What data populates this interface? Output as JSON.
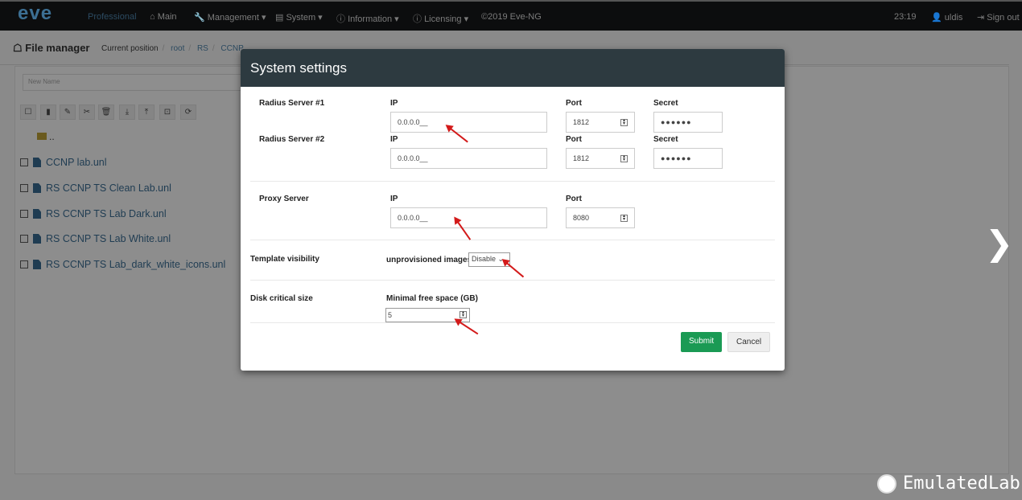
{
  "nav": {
    "logo": "eve",
    "edition": "Professional",
    "items": [
      "Main",
      "Management ▾",
      "System ▾",
      "Information ▾",
      "Licensing ▾"
    ],
    "copyright": "©2019 Eve-NG",
    "time": "23:19",
    "user": "uldis",
    "signout": "Sign out"
  },
  "file_manager": {
    "title": "File manager",
    "current_position": "Current position",
    "breadcrumb": [
      "root",
      "RS",
      "CCNP"
    ],
    "new_name_placeholder": "New Name",
    "up": "..",
    "files": [
      "CCNP lab.unl",
      "RS CCNP TS Clean Lab.unl",
      "RS CCNP TS Lab Dark.unl",
      "RS CCNP TS Lab White.unl",
      "RS CCNP TS Lab_dark_white_icons.unl"
    ],
    "toolbar_icons": [
      "select-all-icon",
      "new-file-icon",
      "edit-icon",
      "cut-icon",
      "delete-icon",
      "import-icon",
      "export-icon",
      "new-folder-icon",
      "refresh-icon"
    ]
  },
  "modal": {
    "title": "System settings",
    "radius1": {
      "label": "Radius Server #1",
      "ip_label": "IP",
      "ip": "0.0.0.0__",
      "port_label": "Port",
      "port": "1812",
      "secret_label": "Secret",
      "secret": "●●●●●●"
    },
    "radius2": {
      "label": "Radius Server #2",
      "ip_label": "IP",
      "ip": "0.0.0.0__",
      "port_label": "Port",
      "port": "1812",
      "secret_label": "Secret",
      "secret": "●●●●●●"
    },
    "proxy": {
      "label": "Proxy Server",
      "ip_label": "IP",
      "ip": "0.0.0.0__",
      "port_label": "Port",
      "port": "8080"
    },
    "template": {
      "label": "Template visibility",
      "field_label": "unprovisioned images",
      "value": "Disable"
    },
    "disk": {
      "label": "Disk critical size",
      "field_label": "Minimal free space (GB)",
      "value": "5"
    },
    "submit": "Submit",
    "cancel": "Cancel"
  },
  "watermark": "EmulatedLab",
  "colors": {
    "navbar": "#0c0d0e",
    "modal_header": "#2d3a40",
    "submit": "#1a9a54",
    "annotation_arrow": "#d31a1a"
  }
}
